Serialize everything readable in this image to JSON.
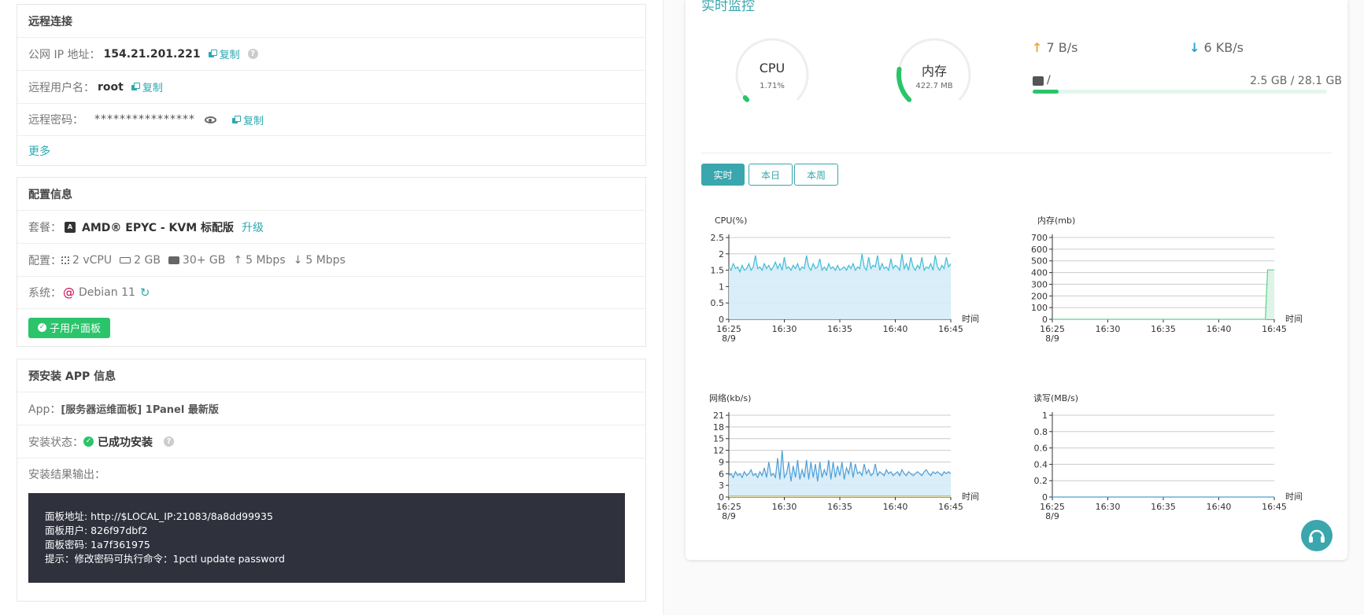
{
  "remote": {
    "title": "远程连接",
    "ip_label": "公网 IP 地址：",
    "ip_value": "154.21.201.221",
    "user_label": "远程用户名：",
    "user_value": "root",
    "pass_label": "远程密码：",
    "pass_value": "****************",
    "copy_label": "复制",
    "more_label": "更多"
  },
  "config": {
    "title": "配置信息",
    "plan_label": "套餐：",
    "plan_value": "AMD® EPYC - KVM 标配版",
    "upgrade_label": "升级",
    "spec_label": "配置：",
    "cpu": "2 vCPU",
    "ram": "2 GB",
    "disk": "30+ GB",
    "up": "5 Mbps",
    "down": "5 Mbps",
    "os_label": "系统：",
    "os_value": "Debian 11",
    "subuser_button": "子用户面板"
  },
  "app": {
    "title": "预安装 APP 信息",
    "app_label": "App：",
    "app_value": "[服务器运维面板] 1Panel 最新版",
    "status_label": "安装状态：",
    "status_value": "已成功安装",
    "output_label": "安装结果输出：",
    "output_lines": [
      "面板地址: http://$LOCAL_IP:21083/8a8dd99935",
      "面板用户:  826f97dbf2",
      "面板密码:  1a7f361975",
      "提示：修改密码可执行命令：1pctl update password"
    ]
  },
  "monitor": {
    "title": "实时监控",
    "cpu_label": "CPU",
    "cpu_value": "1.71%",
    "cpu_fraction": 0.017,
    "mem_label": "内存",
    "mem_value": "422.7 MB",
    "mem_fraction": 0.2,
    "net_up": "7 B/s",
    "net_down": "6 KB/s",
    "disk_path": "/",
    "disk_usage": "2.5 GB / 28.1 GB",
    "disk_fraction": 0.089,
    "tabs": [
      "实时",
      "本日",
      "本周"
    ],
    "active_tab": 0,
    "colors": {
      "accent": "#3aa6ad",
      "green": "#2bc46b",
      "up": "#f0a63a",
      "down": "#26a4c9"
    }
  },
  "chart_data": [
    {
      "type": "area",
      "title": "CPU(%)",
      "xlabel": "时间",
      "x_ticks": [
        "16:25\n8/9",
        "16:30",
        "16:35",
        "16:40",
        "16:45"
      ],
      "y_ticks": [
        "0",
        "0.5",
        "1",
        "1.5",
        "2",
        "2.5"
      ],
      "ylim": [
        0,
        2.5
      ],
      "series": [
        {
          "values": [
            1.6,
            1.5,
            1.7,
            1.55,
            1.6,
            1.45,
            1.65,
            1.5,
            1.55,
            1.7,
            1.5,
            1.6,
            1.95,
            1.55,
            1.6,
            1.5,
            1.7,
            1.55,
            1.65,
            1.5,
            1.6,
            1.75,
            1.55,
            1.7,
            1.5,
            1.9,
            1.55,
            1.6,
            1.5,
            1.65,
            1.55,
            1.7,
            1.5,
            1.6,
            1.55,
            1.95,
            1.6,
            1.5,
            1.7,
            1.55,
            1.6,
            1.85,
            1.5,
            1.6,
            1.5,
            1.7,
            1.55,
            1.6,
            1.5,
            1.65,
            1.5,
            1.55,
            1.6,
            1.5,
            1.65,
            1.55,
            1.7,
            1.5,
            1.6,
            1.55,
            2.0,
            1.6,
            1.5,
            1.9,
            1.55,
            1.65,
            1.6,
            1.95,
            1.5,
            1.7,
            1.55,
            1.6,
            1.5,
            1.85,
            1.55,
            1.65,
            1.6,
            1.5,
            2.0,
            1.55,
            1.7,
            1.5,
            1.9,
            1.6,
            1.5,
            1.65,
            1.55,
            1.9,
            1.5,
            1.6,
            1.55,
            1.7,
            1.5,
            1.95,
            1.6,
            1.5,
            1.65,
            1.55,
            1.9,
            1.6,
            1.7
          ]
        }
      ]
    },
    {
      "type": "area",
      "title": "内存(mb)",
      "xlabel": "时间",
      "x_ticks": [
        "16:25\n8/9",
        "16:30",
        "16:35",
        "16:40",
        "16:45"
      ],
      "y_ticks": [
        "0",
        "100",
        "200",
        "300",
        "400",
        "500",
        "600",
        "700"
      ],
      "ylim": [
        0,
        700
      ],
      "series": [
        {
          "values": [
            0,
            0,
            0,
            0,
            0,
            0,
            0,
            0,
            0,
            0,
            0,
            0,
            0,
            0,
            0,
            0,
            0,
            0,
            0,
            0,
            0,
            0,
            0,
            0,
            0,
            0,
            0,
            0,
            0,
            0,
            0,
            0,
            0,
            0,
            0,
            0,
            0,
            0,
            0,
            0,
            0,
            0,
            0,
            0,
            0,
            0,
            0,
            0,
            0,
            0,
            0,
            0,
            0,
            0,
            0,
            0,
            0,
            0,
            0,
            0,
            0,
            0,
            0,
            0,
            0,
            0,
            0,
            0,
            0,
            0,
            0,
            0,
            0,
            0,
            0,
            0,
            0,
            0,
            0,
            0,
            0,
            0,
            0,
            0,
            0,
            0,
            0,
            0,
            0,
            0,
            0,
            0,
            0,
            0,
            0,
            0,
            0,
            423,
            423,
            423,
            423
          ]
        }
      ]
    },
    {
      "type": "area",
      "title": "网络(kb/s)",
      "xlabel": "时间",
      "x_ticks": [
        "16:25\n8/9",
        "16:30",
        "16:35",
        "16:40",
        "16:45"
      ],
      "y_ticks": [
        "0",
        "3",
        "6",
        "9",
        "12",
        "15",
        "18",
        "21"
      ],
      "ylim": [
        0,
        21
      ],
      "series": [
        {
          "values": [
            5.5,
            6,
            5,
            6.5,
            5.5,
            6,
            5,
            6.5,
            5.5,
            6,
            7,
            5.5,
            6,
            5,
            6.5,
            5.5,
            7.5,
            5,
            9,
            5.5,
            6,
            5,
            10,
            4.5,
            12,
            5,
            6,
            9,
            4,
            8,
            5,
            9.5,
            4.5,
            7,
            5,
            9.5,
            4.5,
            9,
            5,
            8.5,
            4,
            9,
            5,
            7,
            5.5,
            9.5,
            4.5,
            9,
            5,
            8,
            5.5,
            9,
            4.5,
            7.5,
            6,
            9,
            5,
            8.5,
            6,
            6.5,
            5.5,
            8.5,
            6,
            7,
            5.5,
            6,
            8.5,
            5.5,
            6.5,
            6,
            5.5,
            7,
            6,
            6.5,
            5.5,
            6,
            6.5,
            5.5,
            7,
            6,
            5.5,
            6.5,
            6,
            5.5,
            6,
            6.5,
            6,
            5.5,
            6.5,
            7,
            6,
            5.5,
            6.5,
            6,
            6.5,
            6,
            5.5,
            6.5,
            6,
            6.5,
            6
          ]
        },
        {
          "values": [
            0.3,
            0.3,
            0.3,
            0.3,
            0.3,
            0.3,
            0.3,
            0.3,
            0.3,
            0.3,
            0.3,
            0.3,
            0.3,
            0.3,
            0.3,
            0.3,
            0.3,
            0.3,
            0.3,
            0.3,
            0.3,
            0.3,
            0.3,
            0.3,
            0.3,
            0.3,
            0.3,
            0.3,
            0.3,
            0.3,
            0.3,
            0.3,
            0.3,
            0.3,
            0.3,
            0.3,
            0.3,
            0.3,
            0.3,
            0.3,
            0.3,
            0.3,
            0.3,
            0.3,
            0.3,
            0.3,
            0.3,
            0.3,
            0.3,
            0.3,
            0.3,
            0.3,
            0.3,
            0.3,
            0.3,
            0.3,
            0.3,
            0.3,
            0.3,
            0.3,
            0.3,
            0.3,
            0.3,
            0.3,
            0.3,
            0.3,
            0.3,
            0.3,
            0.3,
            0.3,
            0.3,
            0.3,
            0.3,
            0.3,
            0.3,
            0.3,
            0.3,
            0.3,
            0.3,
            0.3,
            0.3,
            0.3,
            0.3,
            0.3,
            0.3,
            0.3,
            0.3,
            0.3,
            0.3,
            0.3,
            0.3,
            0.3,
            0.3,
            0.3,
            0.3,
            0.3,
            0.3,
            0.3,
            0.3,
            0.3
          ]
        }
      ]
    },
    {
      "type": "area",
      "title": "读写(MB/s)",
      "xlabel": "时间",
      "x_ticks": [
        "16:25\n8/9",
        "16:30",
        "16:35",
        "16:40",
        "16:45"
      ],
      "y_ticks": [
        "0",
        "0.2",
        "0.4",
        "0.6",
        "0.8",
        "1"
      ],
      "ylim": [
        0,
        1
      ],
      "series": [
        {
          "values": [
            0,
            0,
            0,
            0,
            0,
            0,
            0,
            0,
            0,
            0,
            0,
            0,
            0,
            0,
            0,
            0,
            0,
            0,
            0,
            0,
            0,
            0,
            0,
            0,
            0,
            0,
            0,
            0,
            0,
            0,
            0,
            0,
            0,
            0,
            0,
            0,
            0,
            0,
            0,
            0,
            0,
            0,
            0,
            0,
            0,
            0,
            0,
            0,
            0,
            0,
            0,
            0,
            0,
            0,
            0,
            0,
            0,
            0,
            0,
            0,
            0,
            0,
            0,
            0,
            0,
            0,
            0,
            0,
            0,
            0,
            0,
            0,
            0,
            0,
            0,
            0,
            0,
            0,
            0,
            0,
            0,
            0,
            0,
            0,
            0,
            0,
            0,
            0,
            0,
            0,
            0,
            0,
            0,
            0,
            0,
            0,
            0,
            0,
            0,
            0
          ]
        }
      ]
    }
  ]
}
